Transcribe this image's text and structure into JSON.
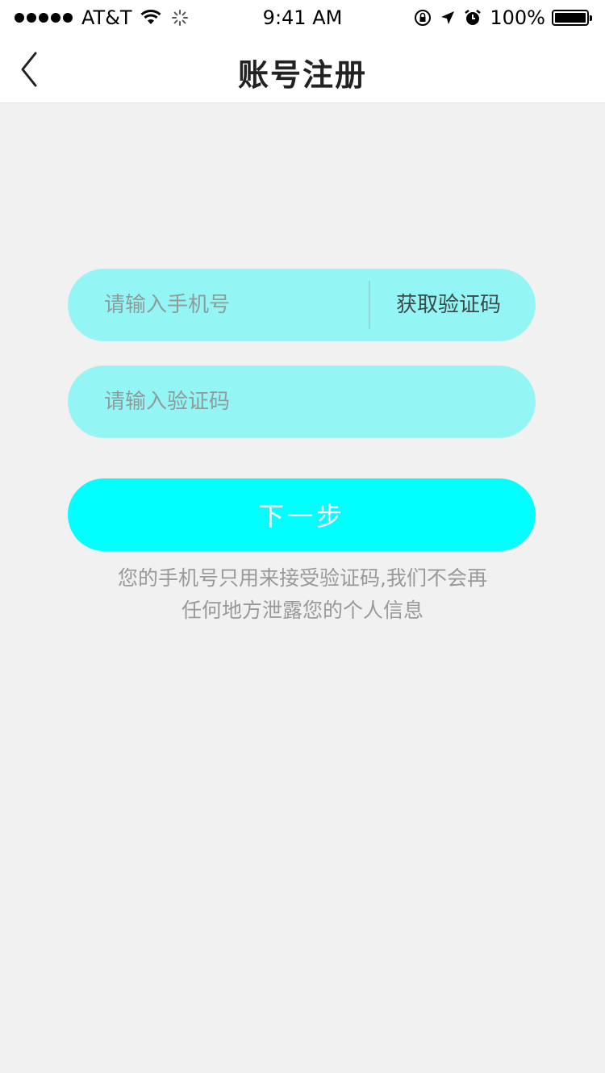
{
  "status_bar": {
    "carrier": "AT&T",
    "time": "9:41 AM",
    "battery": "100%",
    "battery_level": 1.0
  },
  "nav": {
    "title": "账号注册"
  },
  "form": {
    "phone_placeholder": "请输入手机号",
    "get_code_label": "获取验证码",
    "code_placeholder": "请输入验证码",
    "next_label": "下一步"
  },
  "notice": {
    "line1": "您的手机号只用来接受验证码,我们不会再",
    "line2": "任何地方泄露您的个人信息"
  },
  "colors": {
    "background": "#f1f1f1",
    "field": "#93f6f5",
    "primary_button": "#00ffff",
    "notice_text": "#999999"
  },
  "icons": [
    "signal-dots-icon",
    "wifi-icon",
    "activity-spinner-icon",
    "orientation-lock-icon",
    "location-arrow-icon",
    "alarm-clock-icon",
    "battery-icon",
    "back-chevron-icon"
  ]
}
